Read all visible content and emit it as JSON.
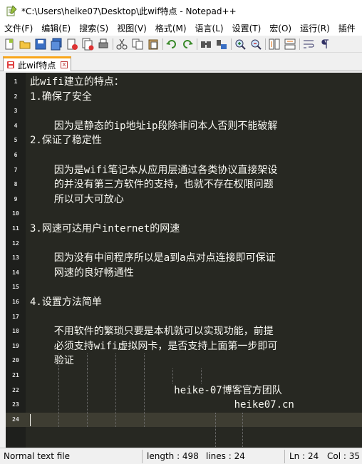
{
  "window": {
    "title": "*C:\\Users\\heike07\\Desktop\\此wif特点 - Notepad++"
  },
  "menu": [
    {
      "label": "文件(F)"
    },
    {
      "label": "编辑(E)"
    },
    {
      "label": "搜索(S)"
    },
    {
      "label": "视图(V)"
    },
    {
      "label": "格式(M)"
    },
    {
      "label": "语言(L)"
    },
    {
      "label": "设置(T)"
    },
    {
      "label": "宏(O)"
    },
    {
      "label": "运行(R)"
    },
    {
      "label": "插件"
    }
  ],
  "toolbar": [
    {
      "icon": "new-file-icon"
    },
    {
      "icon": "open-file-icon"
    },
    {
      "icon": "save-icon"
    },
    {
      "icon": "save-all-icon"
    },
    {
      "icon": "close-file-icon"
    },
    {
      "icon": "close-all-icon"
    },
    {
      "icon": "print-icon"
    },
    {
      "icon": "sep"
    },
    {
      "icon": "cut-icon"
    },
    {
      "icon": "copy-icon"
    },
    {
      "icon": "paste-icon"
    },
    {
      "icon": "sep"
    },
    {
      "icon": "undo-icon"
    },
    {
      "icon": "redo-icon"
    },
    {
      "icon": "sep"
    },
    {
      "icon": "find-icon"
    },
    {
      "icon": "replace-icon"
    },
    {
      "icon": "sep"
    },
    {
      "icon": "zoom-in-icon"
    },
    {
      "icon": "zoom-out-icon"
    },
    {
      "icon": "sep"
    },
    {
      "icon": "sync-vertical-icon"
    },
    {
      "icon": "sync-horizontal-icon"
    },
    {
      "icon": "sep"
    },
    {
      "icon": "word-wrap-icon"
    },
    {
      "icon": "show-all-chars-icon"
    }
  ],
  "tab": {
    "label": "此wif特点",
    "close": "x"
  },
  "editor": {
    "lines": [
      {
        "num": "1",
        "text": "此wifi建立的特点："
      },
      {
        "num": "2",
        "text": "1.确保了安全"
      },
      {
        "num": "3",
        "text": ""
      },
      {
        "num": "4",
        "text": "    因为是静态的ip地址ip段除非问本人否则不能破解"
      },
      {
        "num": "5",
        "text": "2.保证了稳定性"
      },
      {
        "num": "6",
        "text": ""
      },
      {
        "num": "7",
        "text": "    因为是wifi笔记本从应用层通过各类协议直接架设"
      },
      {
        "num": "8",
        "text": "    的并没有第三方软件的支持，也就不存在权限问题"
      },
      {
        "num": "9",
        "text": "    所以可大可放心"
      },
      {
        "num": "10",
        "text": ""
      },
      {
        "num": "11",
        "text": "3.网速可达用户internet的网速"
      },
      {
        "num": "12",
        "text": ""
      },
      {
        "num": "13",
        "text": "    因为没有中间程序所以是a到a点对点连接即可保证"
      },
      {
        "num": "14",
        "text": "    网速的良好畅通性"
      },
      {
        "num": "15",
        "text": ""
      },
      {
        "num": "16",
        "text": "4.设置方法简单"
      },
      {
        "num": "17",
        "text": ""
      },
      {
        "num": "18",
        "text": "    不用软件的繁琐只要是本机就可以实现功能，前提"
      },
      {
        "num": "19",
        "text": "    必须支持wifi虚拟网卡，是否支持上面第一步即可"
      },
      {
        "num": "20",
        "text": "    验证"
      },
      {
        "num": "21",
        "text": ""
      },
      {
        "num": "22",
        "text": "                        heike-07博客官方团队"
      },
      {
        "num": "23",
        "text": "                                  heike07.cn"
      },
      {
        "num": "24",
        "text": ""
      }
    ]
  },
  "status": {
    "filetype": "Normal text file",
    "length": "length : 498",
    "lines": "lines : 24",
    "ln": "Ln : 24",
    "col": "Col : 35"
  },
  "colors": {
    "editor_bg": "#272822",
    "editor_fg": "#f8f8f2",
    "tab_accent": "#f9a51a"
  }
}
